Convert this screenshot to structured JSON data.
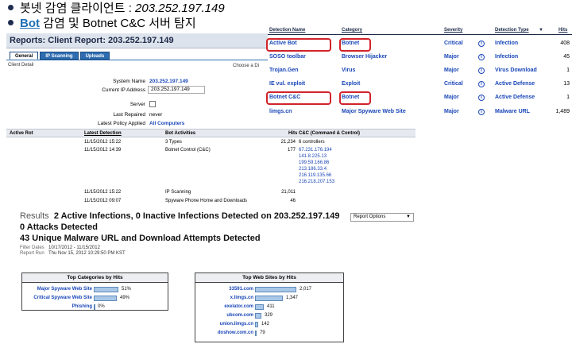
{
  "slide": {
    "bullet1_text": "봇넷 감염 클라이언트 : ",
    "bullet1_ip": "203.252.197.149",
    "bullet2_keyword": "Bot",
    "bullet2_text": " 감염 및 Botnet C&C 서버 탐지"
  },
  "report": {
    "title": "Reports: Client Report: 203.252.197.149",
    "tabs": [
      "General",
      "IP Scanning",
      "Uploads"
    ],
    "client_detail_label": "Client Detail",
    "choose_label": "Choose a Di",
    "fields": {
      "system_name_label": "System Name",
      "system_name_value": "203.252.197.149",
      "current_ip_label": "Current IP Address",
      "current_ip_value": "203.252.197.149",
      "server_label": "Server",
      "last_repaired_label": "Last Repaired",
      "last_repaired_value": "never",
      "latest_policy_label": "Latest Policy Applied",
      "latest_policy_value": "All Computers"
    },
    "table": {
      "headers": [
        "Active Rot",
        "Latest Detection",
        "Bot Activities",
        "Hits",
        "C&C (Command & Control)"
      ],
      "rows": [
        {
          "date": "11/15/2012 15:22",
          "activity": "3 Types",
          "hits": "21,234",
          "cc": "6 controllers"
        },
        {
          "date": "11/15/2012 14:39",
          "activity": "Botnet Control (C&C)",
          "hits": "177",
          "cc": "67.231.176.194"
        },
        {
          "cc": "141.8.225.13"
        },
        {
          "cc": "199.59.166.86"
        },
        {
          "cc": "213.186.33.4"
        },
        {
          "cc": "216.119.135.66"
        },
        {
          "cc": "216.218.207.153"
        },
        {
          "date": "11/15/2012 15:22",
          "activity": "IP Scanning",
          "hits": "21,011"
        },
        {
          "date": "11/15/2012 09:07",
          "activity": "Spyware Phone Home and Downloads",
          "hits": "46"
        }
      ]
    }
  },
  "detections": {
    "headers": [
      "Detection Name",
      "Category",
      "Severity",
      "Detection Type",
      "Hits"
    ],
    "sort_indicator": "▼",
    "rows": [
      {
        "name": "Active Bot",
        "category": "Botnet",
        "severity": "Critical",
        "type": "Infection",
        "hits": "408"
      },
      {
        "name": "SOSO toolbar",
        "category": "Browser Hijacker",
        "severity": "Major",
        "type": "Infection",
        "hits": "45"
      },
      {
        "name": "Trojan.Gen",
        "category": "Virus",
        "severity": "Major",
        "type": "Virus Download",
        "hits": "1"
      },
      {
        "name": "IE vul. exploit",
        "category": "Exploit",
        "severity": "Critical",
        "type": "Active Defense",
        "hits": "13"
      },
      {
        "name": "Botnet C&C",
        "category": "Botnet",
        "severity": "Major",
        "type": "Active Defense",
        "hits": "1"
      },
      {
        "name": "limgs.cn",
        "category": "Major Spyware Web Site",
        "severity": "Major",
        "type": "Malware URL",
        "hits": "1,489"
      }
    ]
  },
  "results": {
    "prefix": "Results",
    "line1": "2 Active Infections, 0 Inactive Infections Detected on 203.252.197.149",
    "line2": "0 Attacks Detected",
    "line3": "43 Unique Malware URL and Download Attempts Detected",
    "filter_label": "Filter Dates",
    "filter_value": "10/17/2012 - 11/15/2012",
    "report_run_label": "Report Run",
    "report_run_value": "Thu Nov 15, 2012 10:29:50 PM KST",
    "report_options": "Report Options"
  },
  "chart_data": [
    {
      "type": "bar",
      "title": "Top Categories by Hits",
      "categories": [
        "Major Spyware Web Site",
        "Critical Spyware Web Site",
        "Phishing"
      ],
      "values": [
        51,
        49,
        0
      ],
      "value_labels": [
        "51%",
        "49%",
        "0%"
      ]
    },
    {
      "type": "bar",
      "title": "Top Web Sites by Hits",
      "categories": [
        "33591.com",
        "x.limgs.cn",
        "exelator.com",
        "ubcom.com",
        "union.limgs.cn",
        "doshow.com.cn"
      ],
      "values": [
        2017,
        1347,
        411,
        329,
        142,
        79
      ],
      "value_labels": [
        "2,017",
        "1,347",
        "411",
        "329",
        "142",
        "79"
      ]
    }
  ]
}
